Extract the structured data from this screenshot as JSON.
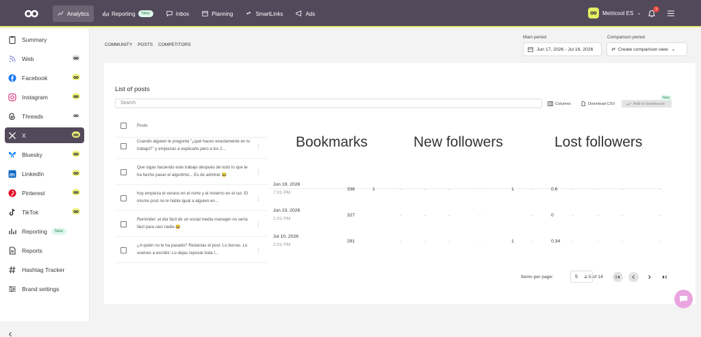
{
  "topbar": {
    "nav": [
      {
        "label": "Analytics",
        "icon": "chart-line-icon",
        "active": true
      },
      {
        "label": "Reporting",
        "icon": "bar-chart-icon",
        "badge": "New"
      },
      {
        "label": "Inbox",
        "icon": "chat-icon"
      },
      {
        "label": "Planning",
        "icon": "calendar-icon"
      },
      {
        "label": "SmartLinks",
        "icon": "link-icon"
      },
      {
        "label": "Ads",
        "icon": "megaphone-icon"
      }
    ],
    "account": "Metricool ES",
    "notifications": "3",
    "accent": "#e4ef66",
    "bar_color": "#52495a"
  },
  "sidebar": {
    "items": [
      {
        "label": "Summary",
        "icon": "clipboard-icon"
      },
      {
        "label": "Web",
        "icon": "rss-icon"
      },
      {
        "label": "Facebook",
        "icon": "facebook-icon"
      },
      {
        "label": "Instagram",
        "icon": "instagram-icon"
      },
      {
        "label": "Threads",
        "icon": "threads-icon"
      },
      {
        "label": "X",
        "icon": "x-icon",
        "active": true
      },
      {
        "label": "Bluesky",
        "icon": "butterfly-icon"
      },
      {
        "label": "LinkedIn",
        "icon": "linkedin-icon"
      },
      {
        "label": "Pinterest",
        "icon": "pinterest-icon"
      },
      {
        "label": "TikTok",
        "icon": "tiktok-icon"
      },
      {
        "label": "Reporting",
        "icon": "bar-chart-icon",
        "badge": "New"
      },
      {
        "label": "Reports",
        "icon": "document-icon"
      },
      {
        "label": "Hashtag Tracker",
        "icon": "hashtag-icon"
      },
      {
        "label": "Brand settings",
        "icon": "sliders-icon"
      }
    ]
  },
  "main": {
    "subtabs": [
      "COMMUNITY",
      "POSTS",
      "COMPETITORS"
    ],
    "main_period_label": "Main period",
    "main_period": "Jun 17, 2026 - Jul 16, 2026",
    "comparison_label": "Comparison period",
    "comparison_value": "Create comparison view",
    "card_title": "List of posts",
    "search_placeholder": "Search",
    "columns_btn": "Columns",
    "download_btn": "Download CSV",
    "add_btn": "Add to dashboard",
    "new_badge": "New",
    "posts_header": "Posts",
    "big_headers": [
      "Bookmarks",
      "New followers",
      "Lost followers"
    ],
    "posts": [
      {
        "text": "Cuando alguien te pregunta \"¿qué haces exactamente en tu trabajo?\" y empiezas a explicarlo pero a los 2..."
      },
      {
        "text": "Que sigas haciendo este trabajo después de todo lo que te ha hecho pasar el algoritmo... Es de admirar 😂"
      },
      {
        "text": "hoy empieza el verano en el norte y el invierno en el sur. El mismo post no le habla igual a alguien en...",
        "date": "Jun 19, 2026",
        "time": "7:01 PM",
        "v1": "336",
        "v2": "1",
        "v3": "1",
        "v4": "0.6"
      },
      {
        "text": "Reminder: el día fácil de un social media manager no sería fácil para casi nadie 😂",
        "date": "Jun 23, 2026",
        "time": "1:01 PM",
        "v1": "327",
        "v2": "",
        "v3": "",
        "v4": "0"
      },
      {
        "text": "¿A quién no le ha pasado? Redactas el post. Lo borras. Lo vuelves a escribir. Lo dejas reposar toda l...",
        "date": "Jul 10, 2026",
        "time": "2:01 PM",
        "v1": "291",
        "v2": "",
        "v3": "1",
        "v4": "0.34"
      }
    ],
    "items_per_page_label": "Items per page:",
    "items_per_page": "5",
    "range": "1-5 of 14"
  }
}
